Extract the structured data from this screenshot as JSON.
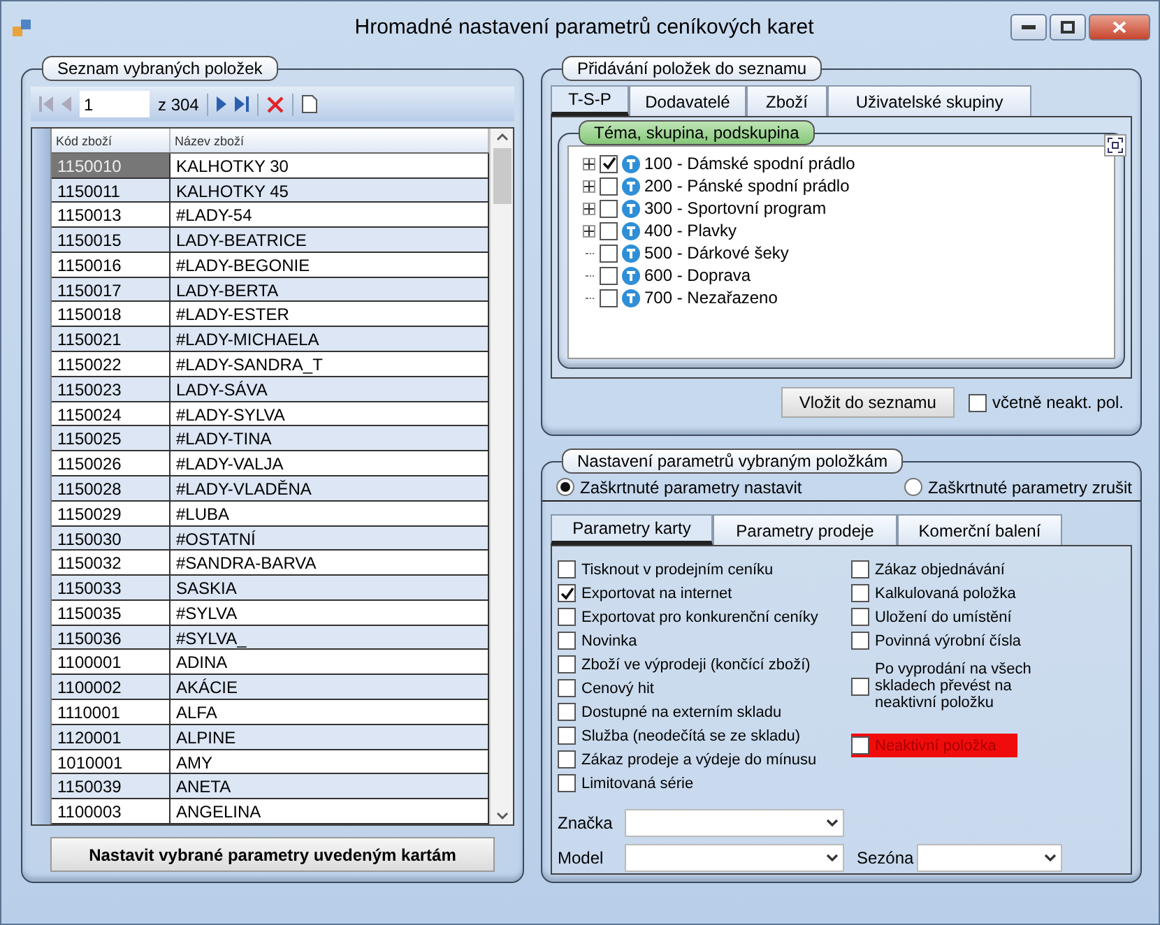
{
  "window": {
    "title": "Hromadné nastavení parametrů ceníkových karet"
  },
  "left_panel": {
    "title": "Seznam vybraných položek",
    "pager": {
      "page": "1",
      "total": "z 304"
    },
    "table": {
      "columns": [
        "Kód zboží",
        "Název zboží"
      ],
      "rows": [
        {
          "code": "1150010",
          "name": "KALHOTKY 30",
          "selected": true
        },
        {
          "code": "1150011",
          "name": "KALHOTKY 45",
          "selected": false
        },
        {
          "code": "1150013",
          "name": "#LADY-54",
          "selected": false
        },
        {
          "code": "1150015",
          "name": "LADY-BEATRICE",
          "selected": false
        },
        {
          "code": "1150016",
          "name": "#LADY-BEGONIE",
          "selected": false
        },
        {
          "code": "1150017",
          "name": "LADY-BERTA",
          "selected": false
        },
        {
          "code": "1150018",
          "name": "#LADY-ESTER",
          "selected": false
        },
        {
          "code": "1150021",
          "name": "#LADY-MICHAELA",
          "selected": false
        },
        {
          "code": "1150022",
          "name": "#LADY-SANDRA_T",
          "selected": false
        },
        {
          "code": "1150023",
          "name": "LADY-SÁVA",
          "selected": false
        },
        {
          "code": "1150024",
          "name": "#LADY-SYLVA",
          "selected": false
        },
        {
          "code": "1150025",
          "name": "#LADY-TINA",
          "selected": false
        },
        {
          "code": "1150026",
          "name": "#LADY-VALJA",
          "selected": false
        },
        {
          "code": "1150028",
          "name": "#LADY-VLADĚNA",
          "selected": false
        },
        {
          "code": "1150029",
          "name": "#LUBA",
          "selected": false
        },
        {
          "code": "1150030",
          "name": "#OSTATNÍ",
          "selected": false
        },
        {
          "code": "1150032",
          "name": "#SANDRA-BARVA",
          "selected": false
        },
        {
          "code": "1150033",
          "name": "SASKIA",
          "selected": false
        },
        {
          "code": "1150035",
          "name": "#SYLVA",
          "selected": false
        },
        {
          "code": "1150036",
          "name": "#SYLVA_",
          "selected": false
        },
        {
          "code": "1100001",
          "name": "ADINA",
          "selected": false
        },
        {
          "code": "1100002",
          "name": "AKÁCIE",
          "selected": false
        },
        {
          "code": "1110001",
          "name": "ALFA",
          "selected": false
        },
        {
          "code": "1120001",
          "name": "ALPINE",
          "selected": false
        },
        {
          "code": "1010001",
          "name": "AMY",
          "selected": false
        },
        {
          "code": "1150039",
          "name": "ANETA",
          "selected": false
        },
        {
          "code": "1100003",
          "name": "ANGELINA",
          "selected": false
        }
      ]
    },
    "button": "Nastavit vybrané parametry uvedeným kartám"
  },
  "add_panel": {
    "title": "Přidávání položek do seznamu",
    "tabs": [
      {
        "label": "T-S-P",
        "selected": true
      },
      {
        "label": "Dodavatelé",
        "selected": false
      },
      {
        "label": "Zboží",
        "selected": false
      },
      {
        "label": "Uživatelské skupiny",
        "selected": false
      }
    ],
    "tree": {
      "title": "Téma, skupina, podskupina",
      "items": [
        {
          "label": "100 - Dámské spodní prádlo",
          "checked": true,
          "expandable": true
        },
        {
          "label": "200 - Pánské spodní prádlo",
          "checked": false,
          "expandable": true
        },
        {
          "label": "300 - Sportovní program",
          "checked": false,
          "expandable": true
        },
        {
          "label": "400 - Plavky",
          "checked": false,
          "expandable": true
        },
        {
          "label": "500 - Dárkové šeky",
          "checked": false,
          "expandable": false
        },
        {
          "label": "600 - Doprava",
          "checked": false,
          "expandable": false
        },
        {
          "label": "700 - Nezařazeno",
          "checked": false,
          "expandable": false
        }
      ]
    },
    "button": "Vložit do seznamu",
    "checkbox": {
      "label": "včetně neakt. pol.",
      "checked": false
    }
  },
  "settings_panel": {
    "title": "Nastavení parametrů vybraným položkám",
    "radios": [
      {
        "label": "Zaškrtnuté parametry nastavit",
        "selected": true
      },
      {
        "label": "Zaškrtnuté parametry zrušit",
        "selected": false
      }
    ],
    "tabs": [
      {
        "label": "Parametry karty",
        "selected": true
      },
      {
        "label": "Parametry prodeje",
        "selected": false
      },
      {
        "label": "Komerční balení",
        "selected": false
      }
    ],
    "left_options": [
      {
        "label": "Tisknout v prodejním ceníku",
        "checked": false
      },
      {
        "label": "Exportovat na internet",
        "checked": true
      },
      {
        "label": "Exportovat pro konkurenční ceníky",
        "checked": false
      },
      {
        "label": "Novinka",
        "checked": false
      },
      {
        "label": "Zboží ve výprodeji (končící zboží)",
        "checked": false
      },
      {
        "label": "Cenový hit",
        "checked": false
      },
      {
        "label": "Dostupné na externím skladu",
        "checked": false
      },
      {
        "label": "Služba (neodečítá se ze skladu)",
        "checked": false
      },
      {
        "label": "Zákaz prodeje a výdeje do mínusu",
        "checked": false
      },
      {
        "label": "Limitovaná série",
        "checked": false
      }
    ],
    "right_options": [
      {
        "label": "Zákaz objednávání",
        "checked": false,
        "highlight": false,
        "kind": "line"
      },
      {
        "label": "Kalkulovaná položka",
        "checked": false,
        "highlight": false,
        "kind": "line"
      },
      {
        "label": "Uložení do umístění",
        "checked": false,
        "highlight": false,
        "kind": "line"
      },
      {
        "label": "Povinná výrobní čísla",
        "checked": false,
        "highlight": false,
        "kind": "line"
      },
      {
        "label": "Po vyprodání na všech skladech převést na neaktivní položku",
        "checked": false,
        "highlight": false,
        "kind": "wrapped"
      },
      {
        "label": "Neaktivní položka",
        "checked": false,
        "highlight": true,
        "kind": "spaced"
      }
    ],
    "combo_rows": [
      [
        {
          "label": "Značka"
        }
      ],
      [
        {
          "label": "Model"
        },
        {
          "label": "Sezóna"
        }
      ]
    ]
  }
}
